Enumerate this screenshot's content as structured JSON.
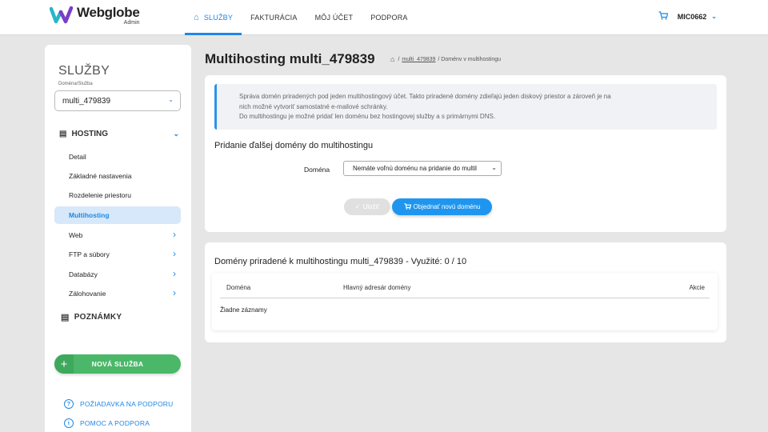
{
  "header": {
    "logo_name": "Webglobe",
    "logo_sub": "Admin",
    "nav": [
      {
        "label": "SLUŽBY",
        "active": true
      },
      {
        "label": "FAKTURÁCIA"
      },
      {
        "label": "MÔJ ÚČET"
      },
      {
        "label": "PODPORA"
      }
    ],
    "user": "MIC0662",
    "accent_color": "#1e88e5"
  },
  "sidebar": {
    "title": "SLUŽBY",
    "select_label": "Doména/Služba",
    "select_value": "multi_479839",
    "hosting_label": "HOSTING",
    "items": [
      {
        "label": "Detail"
      },
      {
        "label": "Základné nastavenia"
      },
      {
        "label": "Rozdelenie priestoru"
      },
      {
        "label": "Multihosting",
        "active": true
      },
      {
        "label": "Web",
        "arrow": true
      },
      {
        "label": "FTP a súbory",
        "arrow": true
      },
      {
        "label": "Databázy",
        "arrow": true
      },
      {
        "label": "Zálohovanie",
        "arrow": true
      }
    ],
    "notes_label": "POZNÁMKY",
    "new_service_label": "NOVÁ SLUŽBA",
    "support_request_label": "POŽIADAVKA NA PODPORU",
    "help_label": "POMOC A PODPORA"
  },
  "main": {
    "title": "Multihosting multi_479839",
    "breadcrumb": {
      "link": "multi_479839",
      "current": "/ Doménv v multihostingu"
    },
    "info_lines": [
      "Správa domén priradených pod jeden multihostingový účet. Takto priradené domény zdieľajú jeden diskový priestor a zároveň je na",
      "nich možné vytvoriť samostatné e-mailové schránky.",
      "Do multihostingu je možné pridať len doménu bez hostingovej služby a s primárnymi DNS."
    ],
    "add_section_title": "Pridanie ďalšej domény do multihostingu",
    "domain_label": "Doména",
    "domain_select_value": "Nemáte voľnú doménu na pridanie do multil",
    "save_label": "Uložiť",
    "order_label": "Objednať novú doménu",
    "assigned_title": "Domény priradené k multihostingu multi_479839 - Využité: 0 / 10",
    "table": {
      "columns": [
        "Doména",
        "Hlavný adresár domény",
        "Akcie"
      ],
      "empty_text": "Žiadne záznamy"
    }
  }
}
